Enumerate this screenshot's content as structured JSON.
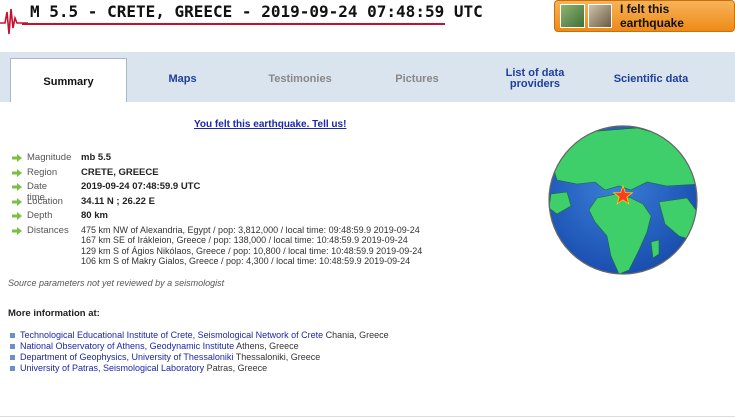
{
  "header": {
    "title": "M 5.5 - CRETE, GREECE - 2019-09-24 07:48:59 UTC",
    "felt_button_label": "I felt this earthquake"
  },
  "tabs": [
    {
      "label": "Summary"
    },
    {
      "label": "Maps"
    },
    {
      "label": "Testimonies"
    },
    {
      "label": "Pictures"
    },
    {
      "label": "List of data providers"
    },
    {
      "label": "Scientific data"
    }
  ],
  "felt_link": "You felt this earthquake. Tell us!",
  "params": [
    {
      "label": "Magnitude",
      "value": "mb 5.5"
    },
    {
      "label": "Region",
      "value": "CRETE, GREECE"
    },
    {
      "label": "Date time",
      "value": "2019-09-24 07:48:59.9 UTC"
    },
    {
      "label": "Location",
      "value": "34.11 N ; 26.22 E"
    },
    {
      "label": "Depth",
      "value": "80 km"
    }
  ],
  "distances_label": "Distances",
  "distances": [
    "475 km NW of Alexandria, Egypt / pop: 3,812,000 / local time: 09:48:59.9 2019-09-24",
    "167 km SE of Irákleion, Greece / pop: 138,000 / local time: 10:48:59.9 2019-09-24",
    "129 km S of Ágios Nikólaos, Greece / pop: 10,800 / local time: 10:48:59.9 2019-09-24",
    "106 km S of Makry Gialos, Greece / pop: 4,300 / local time: 10:48:59.9 2019-09-24"
  ],
  "note": "Source parameters not yet reviewed by a seismologist",
  "more_info_title": "More information at:",
  "more_info": [
    {
      "link": "Technological Educational Institute of Crete, Seismological Network of Crete",
      "place": " Chania, Greece"
    },
    {
      "link": "National Observatory of Athens, Geodynamic Institute",
      "place": " Athens, Greece"
    },
    {
      "link": "Department of Geophysics, University of Thessaloniki",
      "place": " Thessaloniki, Greece"
    },
    {
      "link": "University of Patras, Seismological Laboratory",
      "place": " Patras, Greece"
    }
  ],
  "colors": {
    "accent_red": "#c8102e",
    "tab_band": "#d9e4ef",
    "link_blue": "#1a27a8",
    "felt_button_orange": "#ee8a16"
  }
}
